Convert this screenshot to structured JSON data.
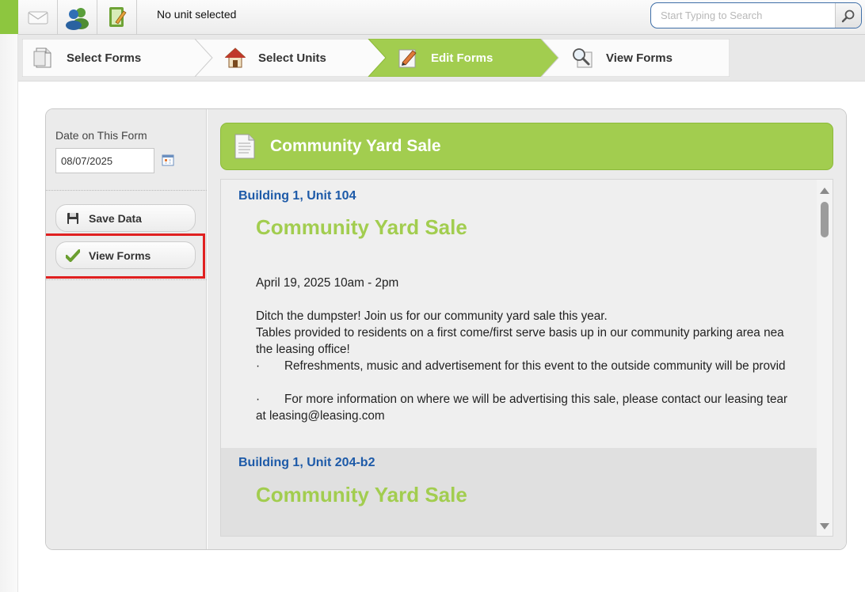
{
  "topbar": {
    "unit_status": "No unit selected",
    "search": {
      "placeholder": "Start Typing to Search",
      "value": ""
    },
    "icons": [
      "mail-icon",
      "users-icon",
      "notebook-icon",
      "search-icon"
    ]
  },
  "wizard": {
    "steps": [
      {
        "label": "Select Forms",
        "icon": "document-icon",
        "active": false
      },
      {
        "label": "Select Units",
        "icon": "house-icon",
        "active": false
      },
      {
        "label": "Edit Forms",
        "icon": "pencil-icon",
        "active": true
      },
      {
        "label": "View Forms",
        "icon": "magnifier-icon",
        "active": false
      }
    ]
  },
  "sidebar": {
    "date_label": "Date on This Form",
    "date_value": "08/07/2025",
    "save_button": "Save Data",
    "view_button": "View Forms"
  },
  "form": {
    "header_title": "Community Yard Sale",
    "records": [
      {
        "unit": "Building 1, Unit 104",
        "title": "Community Yard Sale",
        "body": {
          "date_line": "April 19, 2025 10am - 2pm",
          "line1": "Ditch the dumpster! Join us for our community yard sale this year.",
          "line2": "Tables provided to residents on a first come/first serve basis up in our community parking area nea",
          "line3": "the leasing office!",
          "bullet_mark": "·",
          "bullet1": "Refreshments, music and advertisement for this event to the outside community will be provid",
          "bullet2": "For more information on where we will be advertising this sale, please contact our leasing tear",
          "line4": "at leasing@leasing.com"
        }
      },
      {
        "unit": "Building 1, Unit 204-b2",
        "title": "Community Yard Sale"
      }
    ]
  },
  "colors": {
    "accent_green": "#a2cd4f",
    "unit_link_blue": "#1d5aa8",
    "highlight_red": "#e02020"
  }
}
